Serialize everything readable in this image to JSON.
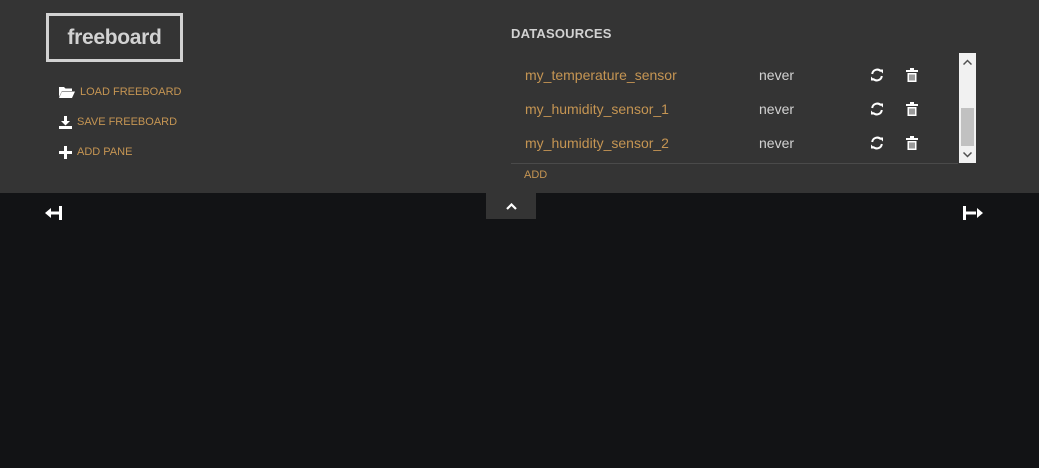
{
  "app": {
    "logo": "freeboard"
  },
  "menu": {
    "load_label": "LOAD FREEBOARD",
    "save_label": "SAVE FREEBOARD",
    "add_pane_label": "ADD PANE"
  },
  "datasources": {
    "title": "DATASOURCES",
    "add_label": "ADD",
    "items": [
      {
        "name": "my_temperature_sensor",
        "last_updated": "never"
      },
      {
        "name": "my_humidity_sensor_1",
        "last_updated": "never"
      },
      {
        "name": "my_humidity_sensor_2",
        "last_updated": "never"
      }
    ]
  },
  "icons": {
    "load": "folder-open-icon",
    "save": "download-icon",
    "add_pane": "plus-icon",
    "refresh": "refresh-icon",
    "delete": "trash-icon",
    "toggle": "chevron-up-icon",
    "column_left": "remove-column-icon",
    "column_right": "add-column-icon"
  },
  "colors": {
    "header_bg": "#343434",
    "page_bg": "#121315",
    "accent": "#c59553",
    "text": "#d2d2d2"
  }
}
